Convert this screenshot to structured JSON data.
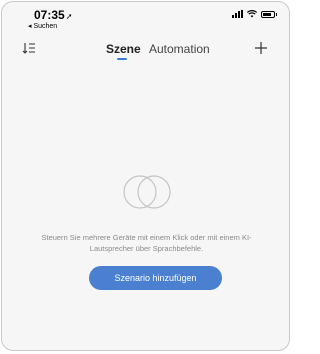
{
  "status_bar": {
    "time": "07:35",
    "location_arrow": "➚",
    "back_label": "◂ Suchen"
  },
  "nav": {
    "sort_icon": "sort-icon",
    "tabs": [
      {
        "label": "Szene",
        "active": true
      },
      {
        "label": "Automation",
        "active": false
      }
    ],
    "add_icon": "plus-icon"
  },
  "empty_state": {
    "icon": "overlapping-circles-icon",
    "text": "Steuern Sie mehrere Geräte mit einem Klick oder mit einem KI-Lautsprecher über Sprachbefehle.",
    "button_label": "Szenario hinzufügen"
  },
  "colors": {
    "accent": "#4a80cf",
    "indicator": "#3a7bd5",
    "background": "#f6f6f6"
  }
}
